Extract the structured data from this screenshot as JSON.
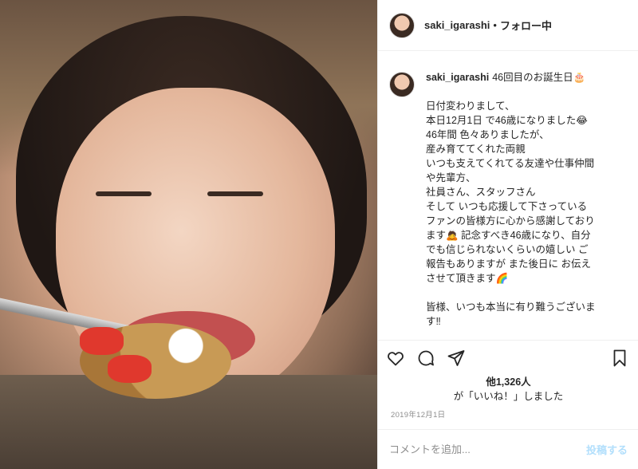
{
  "post": {
    "photo_alt": "",
    "header": {
      "username": "saki_igarashi",
      "separator": "•",
      "follow_status": "フォロー中"
    },
    "caption": {
      "username": "saki_igarashi",
      "text": "46回目のお誕生日🎂\n\n日付変わりまして、\n本日12月1日 で46歳になりました😂\n46年間 色々ありましたが、\n産み育ててくれた両親\nいつも支えてくれてる友達や仕事仲間\nや先輩方、\n社員さん、スタッフさん\nそして いつも応援して下さっている\nファンの皆様方に心から感謝しており\nます🙇 記念すべき46歳になり、自分\nでも信じられないくらいの嬉しい ご\n報告もありますが また後日に お伝え\nさせて頂きます🌈\n\n皆様、いつも本当に有り難うございま\nす‼︎"
    },
    "actions": {
      "like_icon": "heart-icon",
      "comment_icon": "comment-icon",
      "share_icon": "send-icon",
      "save_icon": "bookmark-icon"
    },
    "likes": {
      "count_text": "他1,326人",
      "suffix_text": "が「いいね！」しました"
    },
    "date": "2019年12月1日",
    "comment": {
      "placeholder": "コメントを追加...",
      "post_label": "投稿する"
    }
  },
  "colors": {
    "text": "#262626",
    "secondary": "#8e8e8e",
    "border": "#efefef",
    "post_disabled": "#b2dffc"
  }
}
